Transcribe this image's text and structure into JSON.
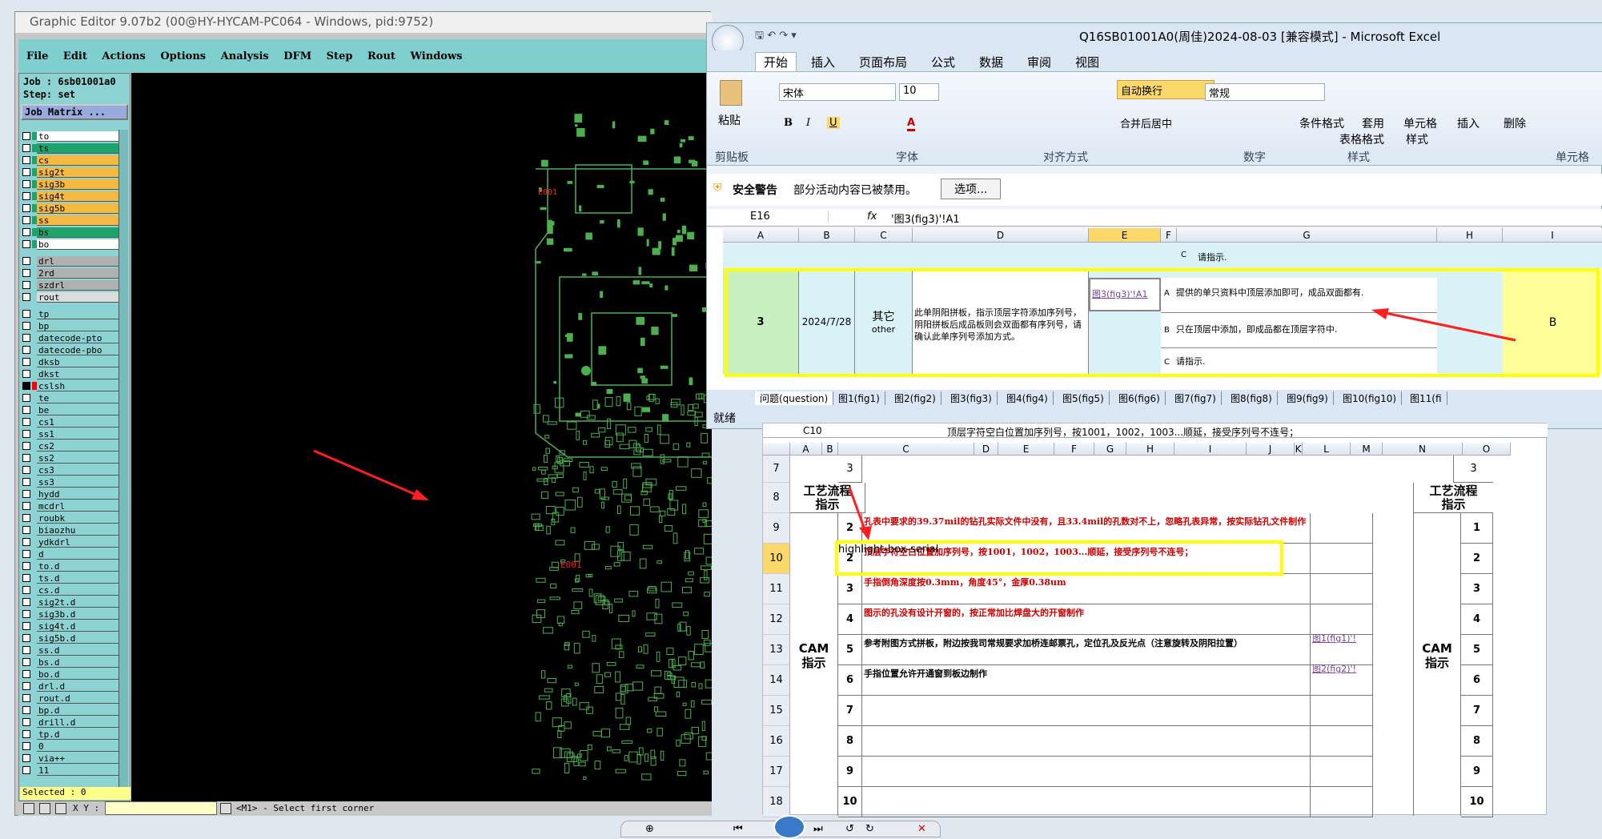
{
  "graphic_editor": {
    "title": "Graphic Editor 9.07b2 (00@HY-HYCAM-PC064 - Windows, pid:9752)",
    "menu": [
      "File",
      "Edit",
      "Actions",
      "Options",
      "Analysis",
      "DFM",
      "Step",
      "Rout",
      "Windows"
    ],
    "job": "Job : 6sb01001a0",
    "step": "Step: set",
    "job_matrix": "Job Matrix ...",
    "layers": [
      {
        "name": "to",
        "color": "#ffffff"
      },
      {
        "name": "ts",
        "color": "#1fa36c"
      },
      {
        "name": "cs",
        "color": "#f5b942"
      },
      {
        "name": "sig2t",
        "color": "#f5b942"
      },
      {
        "name": "sig3b",
        "color": "#f5b942"
      },
      {
        "name": "sig4t",
        "color": "#f5b942"
      },
      {
        "name": "sig5b",
        "color": "#f5b942"
      },
      {
        "name": "ss",
        "color": "#f5b942"
      },
      {
        "name": "bs",
        "color": "#1fa36c"
      },
      {
        "name": "bo",
        "color": "#ffffff"
      },
      {
        "name": "drl",
        "color": "#b0b0b0"
      },
      {
        "name": "2rd",
        "color": "#b0b0b0"
      },
      {
        "name": "szdrl",
        "color": "#b0b0b0"
      },
      {
        "name": "rout",
        "color": "#dcdcdc"
      },
      {
        "name": "tp",
        "color": "#8ed3d3"
      },
      {
        "name": "bp",
        "color": "#8ed3d3"
      },
      {
        "name": "datecode-pto",
        "color": "#8ed3d3"
      },
      {
        "name": "datecode-pbo",
        "color": "#8ed3d3"
      },
      {
        "name": "dksb",
        "color": "#8ed3d3"
      },
      {
        "name": "dkst",
        "color": "#8ed3d3"
      },
      {
        "name": "cslsh",
        "color": "#8ed3d3"
      },
      {
        "name": "te",
        "color": "#8ed3d3"
      },
      {
        "name": "be",
        "color": "#8ed3d3"
      },
      {
        "name": "cs1",
        "color": "#8ed3d3"
      },
      {
        "name": "ss1",
        "color": "#8ed3d3"
      },
      {
        "name": "cs2",
        "color": "#8ed3d3"
      },
      {
        "name": "ss2",
        "color": "#8ed3d3"
      },
      {
        "name": "cs3",
        "color": "#8ed3d3"
      },
      {
        "name": "ss3",
        "color": "#8ed3d3"
      },
      {
        "name": "hydd",
        "color": "#8ed3d3"
      },
      {
        "name": "mcdrl",
        "color": "#8ed3d3"
      },
      {
        "name": "roubk",
        "color": "#8ed3d3"
      },
      {
        "name": "biaozhu",
        "color": "#8ed3d3"
      },
      {
        "name": "ydkdrl",
        "color": "#8ed3d3"
      },
      {
        "name": "d",
        "color": "#8ed3d3"
      },
      {
        "name": "to.d",
        "color": "#8ed3d3"
      },
      {
        "name": "ts.d",
        "color": "#8ed3d3"
      },
      {
        "name": "cs.d",
        "color": "#8ed3d3"
      },
      {
        "name": "sig2t.d",
        "color": "#8ed3d3"
      },
      {
        "name": "sig3b.d",
        "color": "#8ed3d3"
      },
      {
        "name": "sig4t.d",
        "color": "#8ed3d3"
      },
      {
        "name": "sig5b.d",
        "color": "#8ed3d3"
      },
      {
        "name": "ss.d",
        "color": "#8ed3d3"
      },
      {
        "name": "bs.d",
        "color": "#8ed3d3"
      },
      {
        "name": "bo.d",
        "color": "#8ed3d3"
      },
      {
        "name": "drl.d",
        "color": "#8ed3d3"
      },
      {
        "name": "rout.d",
        "color": "#8ed3d3"
      },
      {
        "name": "bp.d",
        "color": "#8ed3d3"
      },
      {
        "name": "drill.d",
        "color": "#8ed3d3"
      },
      {
        "name": "tp.d",
        "color": "#8ed3d3"
      },
      {
        "name": "0",
        "color": "#8ed3d3"
      },
      {
        "name": "via++",
        "color": "#8ed3d3"
      },
      {
        "name": "11",
        "color": "#8ed3d3"
      }
    ],
    "selected": "Selected : 0",
    "xy_label": "X Y :",
    "prompt": "<M1> - Select first corner",
    "board_label": "E001",
    "board_label_top": "E001"
  },
  "excel": {
    "title": "Q16SB01001A0(周佳)2024-08-03  [兼容模式] - Microsoft Excel",
    "tabs": [
      "开始",
      "插入",
      "页面布局",
      "公式",
      "数据",
      "审阅",
      "视图"
    ],
    "ribbon": {
      "paste": "粘贴",
      "clipboard": "剪贴板",
      "font_name": "宋体",
      "font_size": "10",
      "font_group": "字体",
      "wrap": "自动换行",
      "merge": "合并后居中",
      "align_group": "对齐方式",
      "number_format": "常规",
      "number_group": "数字",
      "cond_format": "条件格式",
      "table_format_1": "套用",
      "table_format_2": "表格格式",
      "cell_style_1": "单元格",
      "cell_style_2": "样式",
      "style_group": "样式",
      "insert": "插入",
      "delete": "删除",
      "cells_group": "单元格"
    },
    "warning": {
      "label": "安全警告",
      "text": "部分活动内容已被禁用。",
      "button": "选项..."
    },
    "name_box": "E16",
    "formula": "'图3(fig3)'!A1",
    "columns": [
      "A",
      "B",
      "C",
      "D",
      "E",
      "F",
      "G",
      "H",
      "I"
    ],
    "rows": {
      "no": "3",
      "date": "2024/7/28",
      "type_cn": "其它",
      "type_en": "other",
      "desc": "此单阴阳拼板，指示顶层字符添加序列号，阴阳拼板后成品板则会双面都有序列号，请确认此单序列号添加方式。",
      "link": "图3(fig3)'!A1",
      "opt_c_top": "请指示.",
      "opt_a": "提供的单只资料中顶层添加即可，成品双面都有.",
      "opt_b": "只在顶层中添加，即成品都在顶层字符中.",
      "opt_c": "请指示.",
      "answer": "B"
    },
    "sheets": [
      "问题(question)",
      "图1(fig1)",
      "图2(fig2)",
      "图3(fig3)",
      "图4(fig4)",
      "图5(fig5)",
      "图6(fig6)",
      "图7(fig7)",
      "图8(fig8)",
      "图9(fig9)",
      "图10(fig10)",
      "图11(fi"
    ],
    "status": "就绪"
  },
  "sheet2": {
    "name_box": "C10",
    "formula": "顶层字符空白位置加序列号，按1001，1002，1003...顺延，接受序列号不连号；",
    "columns": [
      "A",
      "B",
      "C",
      "D",
      "E",
      "F",
      "G",
      "H",
      "I",
      "J",
      "K",
      "L",
      "M",
      "N",
      "O"
    ],
    "row_numbers": [
      "7",
      "8",
      "9",
      "10",
      "11",
      "12",
      "13",
      "14",
      "15",
      "16",
      "17",
      "18"
    ],
    "process_label": "工艺流程\n指示",
    "cam_label": "CAM\n指示",
    "top_value": "3",
    "items": [
      {
        "n": "2",
        "text": "孔表中要求的39.37mil的钻孔实际文件中没有，且33.4mil的孔数对不上，忽略孔表异常，按实际钻孔文件制作",
        "red": true
      },
      {
        "n": "2",
        "text": "顶层字符空白位置加序列号，按1001，1002，1003...顺延，接受序列号不连号；",
        "red": true
      },
      {
        "n": "3",
        "text": "手指倒角深度按0.3mm，角度45°，金厚0.38um",
        "red": true
      },
      {
        "n": "4",
        "text": "图示的孔没有设计开窗的，按正常加比焊盘大的开窗制作",
        "red": true
      },
      {
        "n": "5",
        "text": "参考附图方式拼板，附边按我司常规要求加桥连邮票孔，定位孔及反光点（注意旋转及阴阳拉置）",
        "red": false
      },
      {
        "n": "6",
        "text": "手指位置允许开通窗到板边制作",
        "red": false
      },
      {
        "n": "7",
        "text": "",
        "red": false
      },
      {
        "n": "8",
        "text": "",
        "red": false
      },
      {
        "n": "9",
        "text": "",
        "red": false
      },
      {
        "n": "10",
        "text": "",
        "red": false
      }
    ],
    "fig_links": [
      "图1(fig1)'!",
      "图2(fig2)'!"
    ],
    "right_numbers": [
      "1",
      "2",
      "3",
      "4",
      "5",
      "6",
      "7",
      "8",
      "9",
      "10"
    ]
  },
  "colors": {
    "highlight": "#ffff00",
    "arrow": "#ff0000",
    "pcb": "#4caf50"
  }
}
